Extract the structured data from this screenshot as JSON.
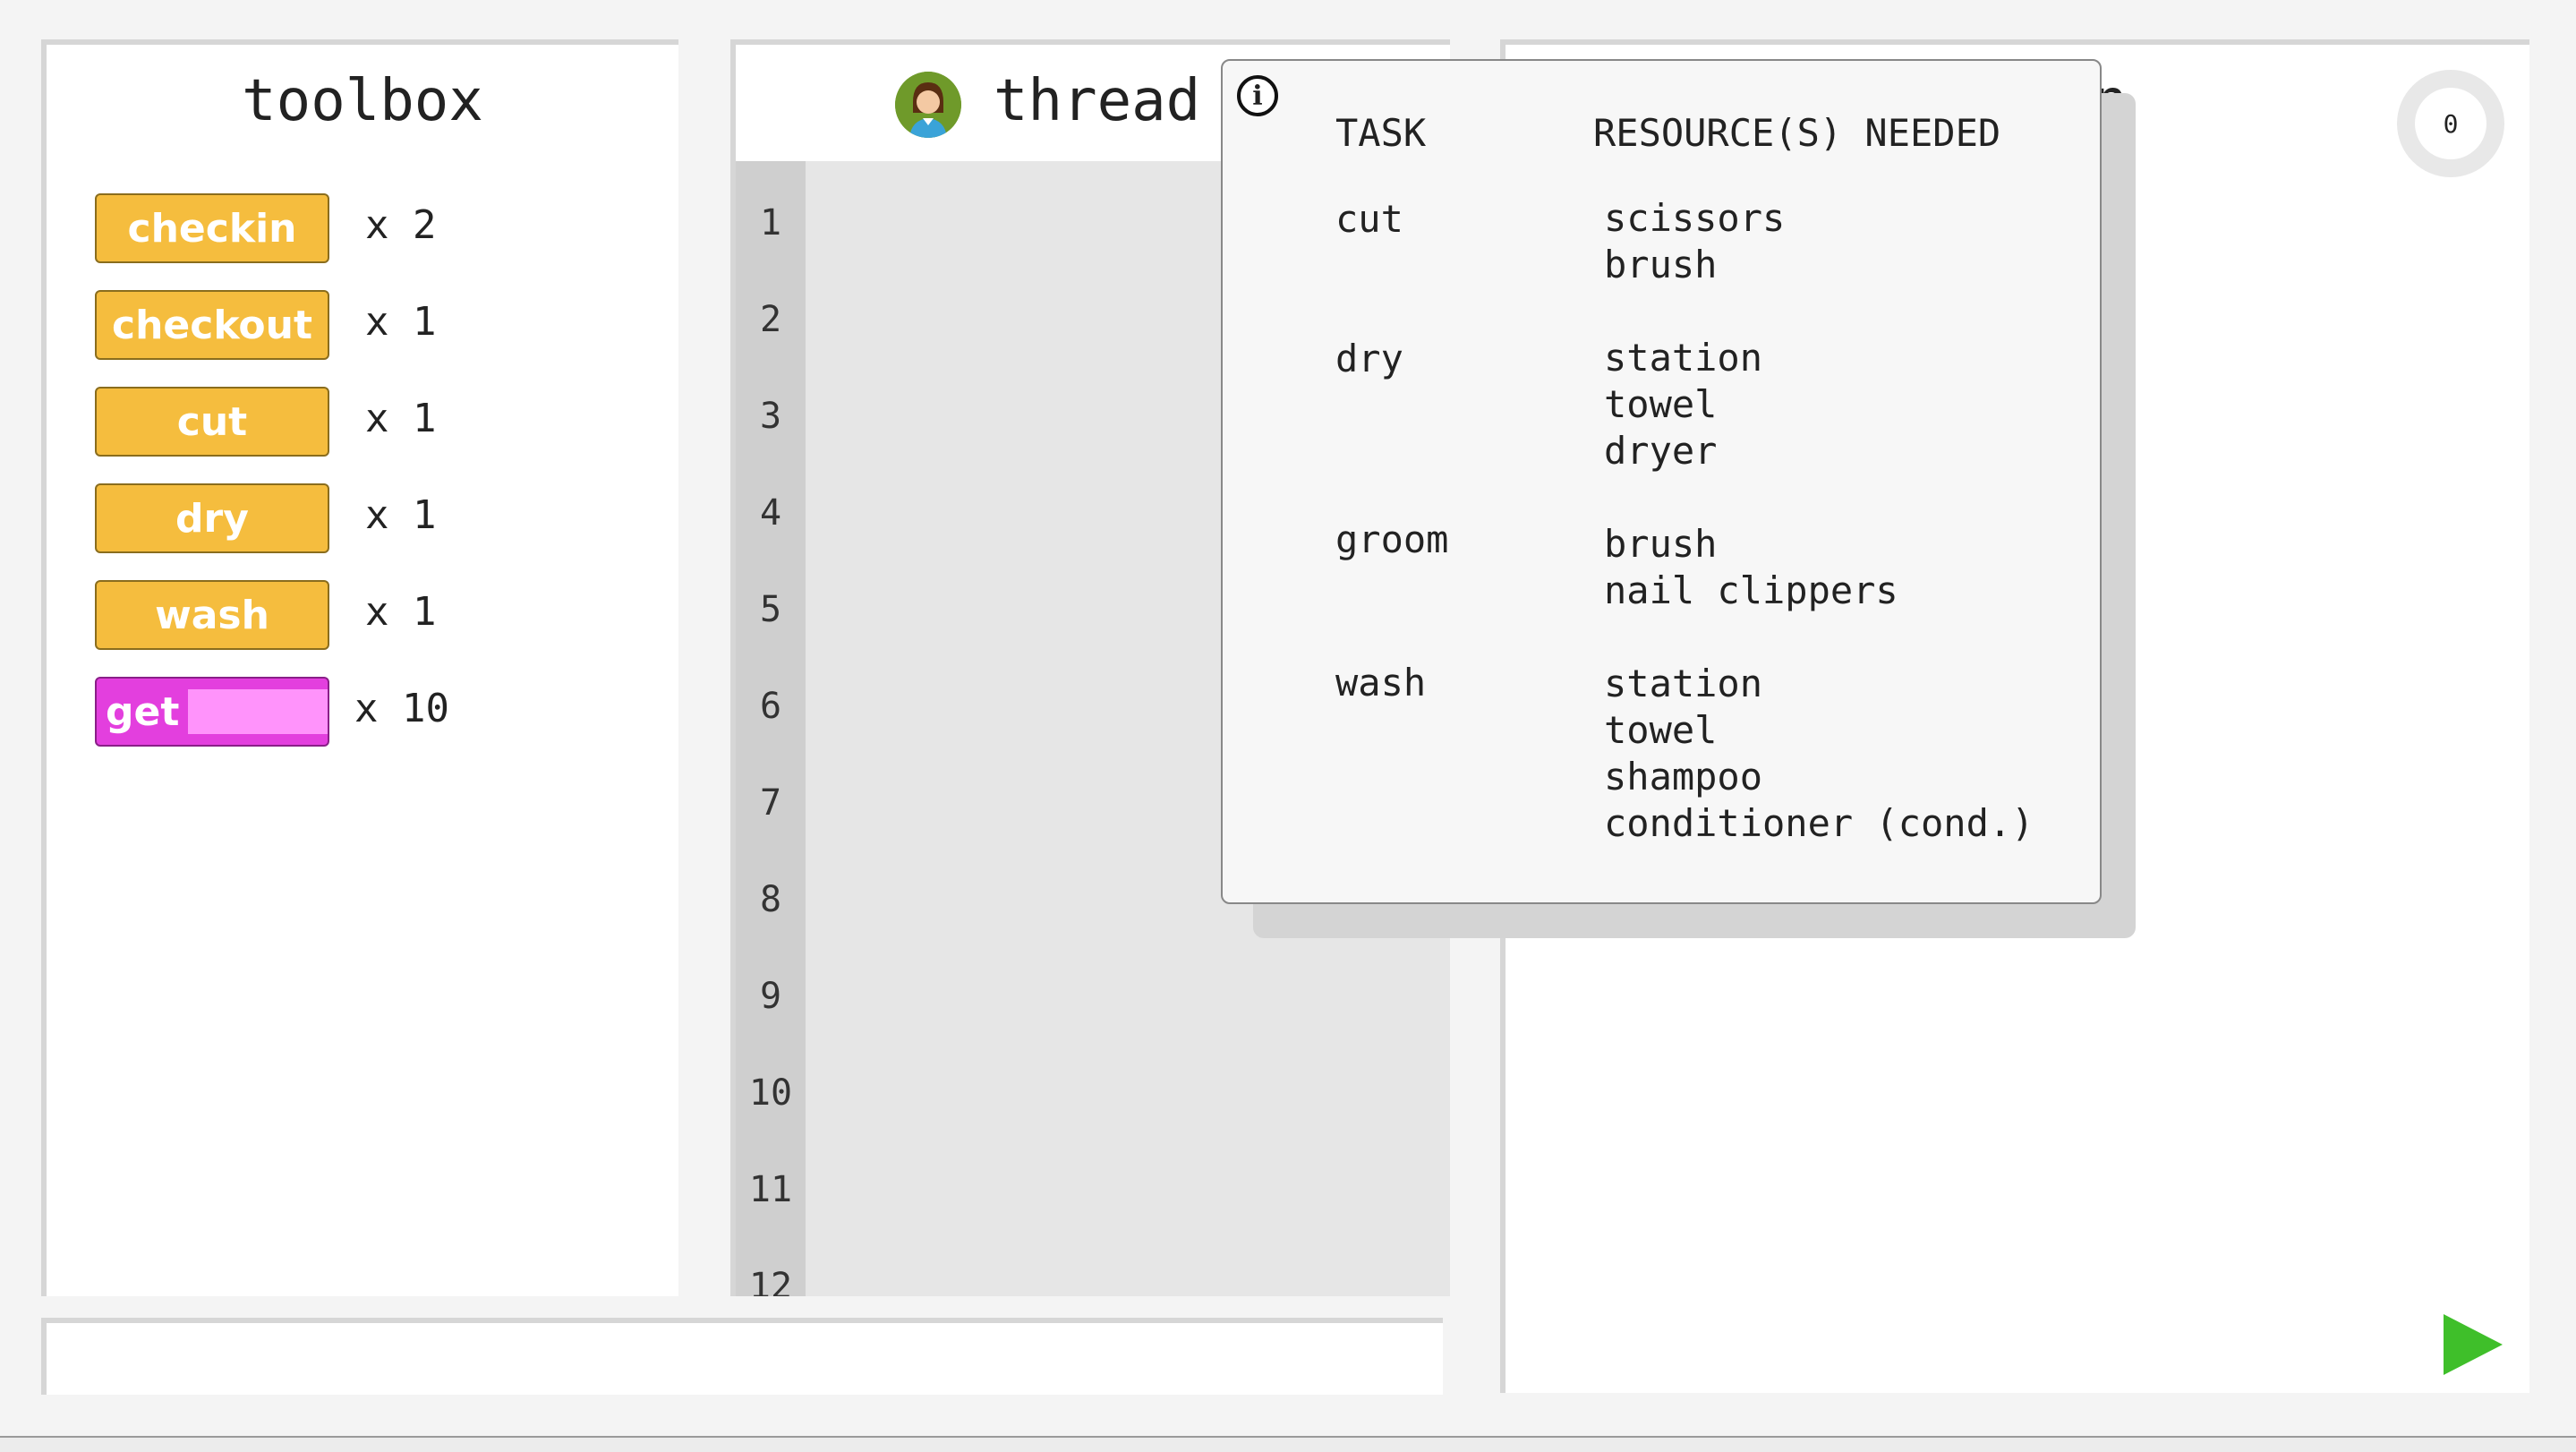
{
  "toolbox": {
    "title": "toolbox",
    "blocks": [
      {
        "label": "checkin",
        "count": "x 2"
      },
      {
        "label": "checkout",
        "count": "x 1"
      },
      {
        "label": "cut",
        "count": "x 1"
      },
      {
        "label": "dry",
        "count": "x 1"
      },
      {
        "label": "wash",
        "count": "x 1"
      },
      {
        "label": "get",
        "count": "x 10"
      }
    ]
  },
  "thread": {
    "title": "thread",
    "line_numbers": [
      "1",
      "2",
      "3",
      "4",
      "5",
      "6",
      "7",
      "8",
      "9",
      "10",
      "11",
      "12"
    ]
  },
  "output": {
    "title_visible": "on",
    "counter": "0"
  },
  "popup": {
    "header_task": "TASK",
    "header_resources": "RESOURCE(S) NEEDED",
    "rows": [
      {
        "task": "cut",
        "resources": [
          "scissors",
          "brush"
        ]
      },
      {
        "task": "dry",
        "resources": [
          "station",
          "towel",
          "dryer"
        ]
      },
      {
        "task": "groom",
        "resources": [
          "brush",
          "nail clippers"
        ]
      },
      {
        "task": "wash",
        "resources": [
          "station",
          "towel",
          "shampoo",
          "conditioner (cond.)"
        ]
      }
    ]
  },
  "colors": {
    "block_yellow": "#f5bd3e",
    "block_magenta": "#e33fde",
    "play_green": "#3fbf2a"
  },
  "icons": {
    "info": "info-icon",
    "play": "play-icon",
    "avatar": "avatar-icon"
  }
}
